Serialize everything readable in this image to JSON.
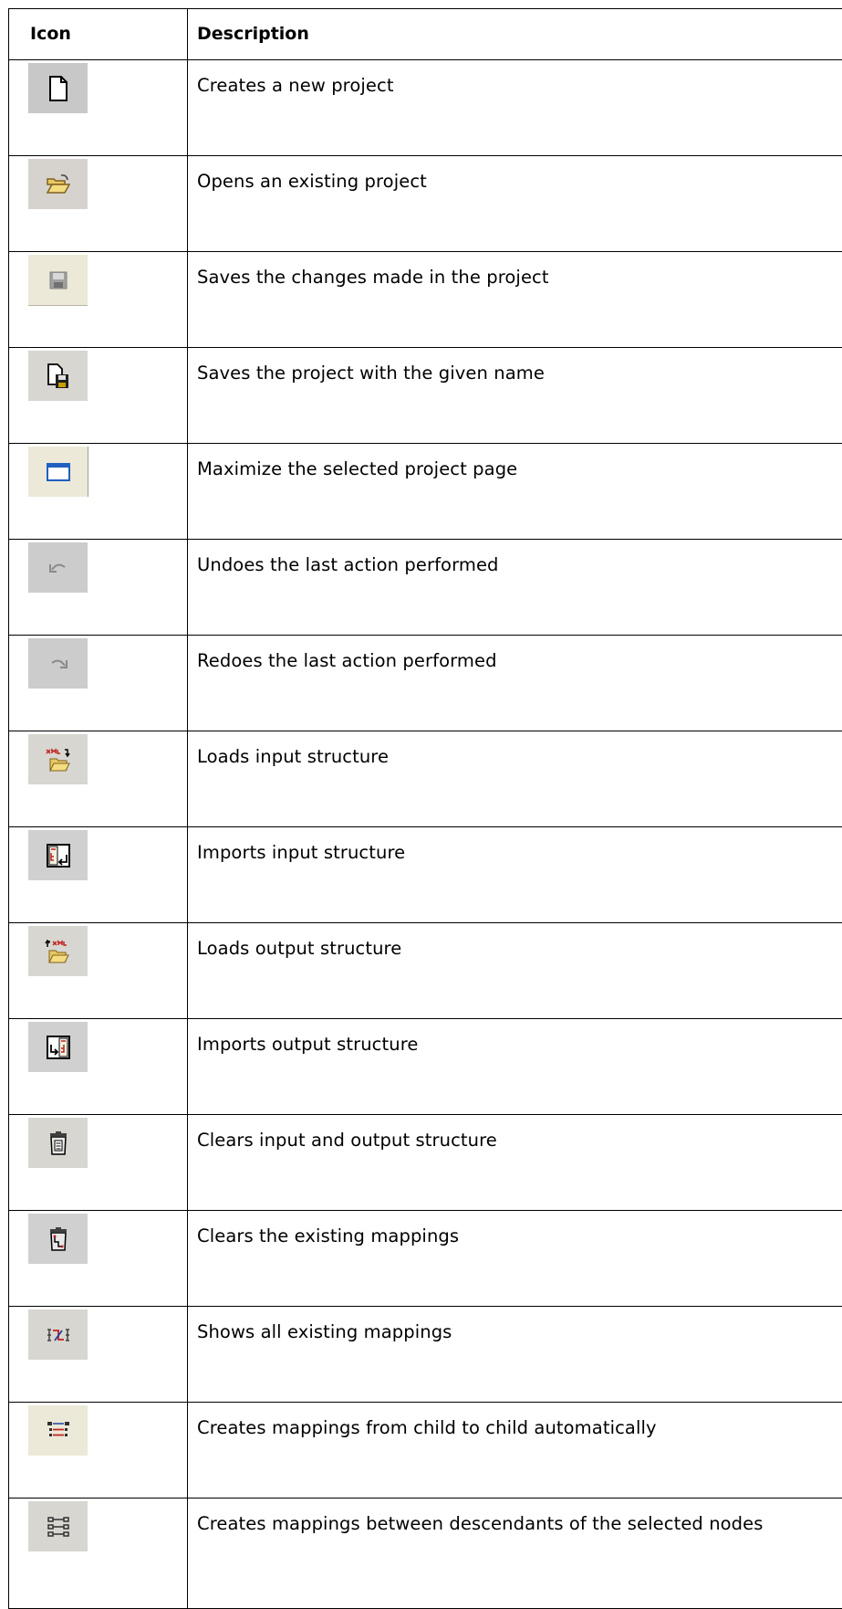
{
  "table": {
    "header": {
      "icon": "Icon",
      "description": "Description"
    },
    "rows": [
      {
        "icon": "new-project-icon",
        "description": "Creates a new project",
        "bg": "#c8c8c8"
      },
      {
        "icon": "open-folder-icon",
        "description": "Opens an existing project",
        "bg": "#d6d3ce"
      },
      {
        "icon": "save-icon",
        "description": "Saves the changes made in the project",
        "bg": "#ece9d8"
      },
      {
        "icon": "save-as-icon",
        "description": "Saves the project with the given name",
        "bg": "#d8d6d0"
      },
      {
        "icon": "maximize-icon",
        "description": "Maximize the selected project page",
        "bg": "#ece9d8"
      },
      {
        "icon": "undo-icon",
        "description": "Undoes the last action performed",
        "bg": "#cccccc"
      },
      {
        "icon": "redo-icon",
        "description": "Redoes the last action performed",
        "bg": "#cccccc"
      },
      {
        "icon": "load-input-xml-icon",
        "description": "Loads input structure",
        "bg": "#d8d6d0"
      },
      {
        "icon": "import-input-structure-icon",
        "description": "Imports input structure",
        "bg": "#d0d0d0"
      },
      {
        "icon": "load-output-xml-icon",
        "description": "Loads output structure",
        "bg": "#d8d6d0"
      },
      {
        "icon": "import-output-structure-icon",
        "description": "Imports output structure",
        "bg": "#d0d0d0"
      },
      {
        "icon": "clear-structures-icon",
        "description": "Clears input and output structure",
        "bg": "#d8d6d0"
      },
      {
        "icon": "clear-mappings-icon",
        "description": "Clears the existing mappings",
        "bg": "#d0d0d0"
      },
      {
        "icon": "show-mappings-icon",
        "description": "Shows all existing mappings",
        "bg": "#d8d6d0"
      },
      {
        "icon": "auto-map-children-icon",
        "description": "Creates mappings from child to child automatically",
        "bg": "#ece9d8"
      },
      {
        "icon": "map-descendants-icon",
        "description": "Creates mappings between descendants of the selected nodes",
        "bg": "#d8d6d0"
      }
    ]
  }
}
